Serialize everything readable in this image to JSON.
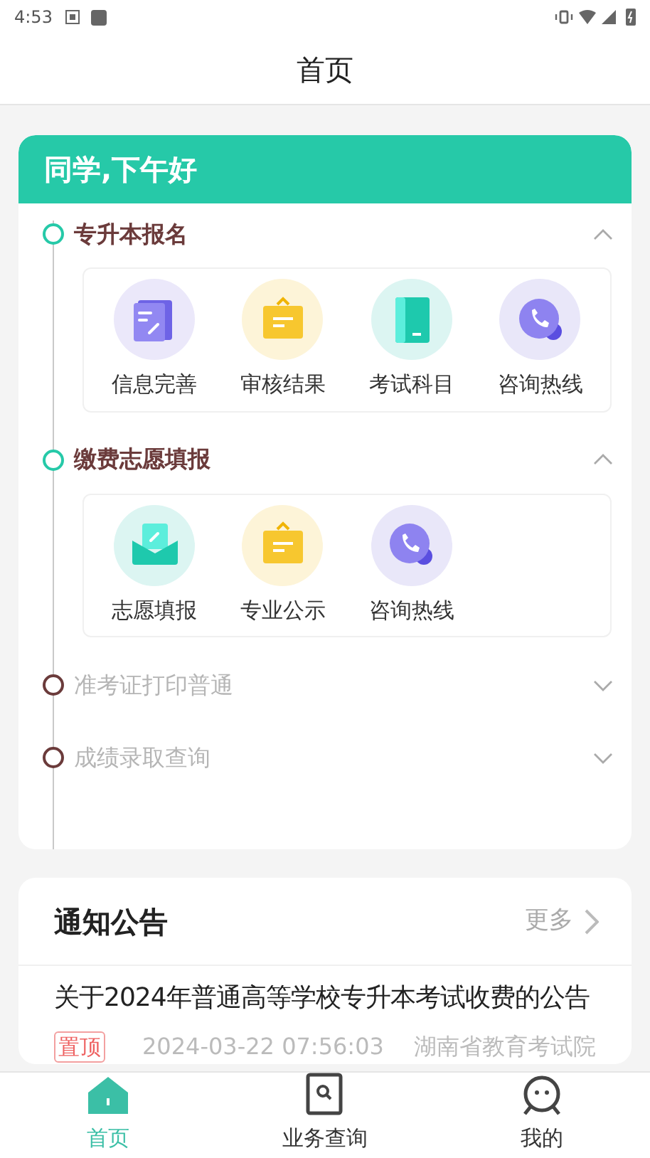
{
  "status_bar": {
    "time": "4:53"
  },
  "header": {
    "title": "首页"
  },
  "greeting": "同学,下午好",
  "sections": [
    {
      "title": "专升本报名",
      "active": true,
      "expanded": true,
      "items": [
        {
          "label": "信息完善",
          "kind": "form"
        },
        {
          "label": "审核结果",
          "kind": "board"
        },
        {
          "label": "考试科目",
          "kind": "book"
        },
        {
          "label": "咨询热线",
          "kind": "phone"
        }
      ]
    },
    {
      "title": "缴费志愿填报",
      "active": true,
      "expanded": true,
      "items": [
        {
          "label": "志愿填报",
          "kind": "envelope"
        },
        {
          "label": "专业公示",
          "kind": "board"
        },
        {
          "label": "咨询热线",
          "kind": "phone"
        }
      ]
    },
    {
      "title": "准考证打印普通",
      "active": false,
      "expanded": false
    },
    {
      "title": "成绩录取查询",
      "active": false,
      "expanded": false
    }
  ],
  "notices": {
    "title": "通知公告",
    "more": "更多",
    "items": [
      {
        "title": "关于2024年普通高等学校专升本考试收费的公告",
        "badge": "置顶",
        "time": "2024-03-22 07:56:03",
        "source": "湖南省教育考试院"
      }
    ]
  },
  "tabs": [
    {
      "label": "首页",
      "selected": true
    },
    {
      "label": "业务查询",
      "selected": false
    },
    {
      "label": "我的",
      "selected": false
    }
  ]
}
